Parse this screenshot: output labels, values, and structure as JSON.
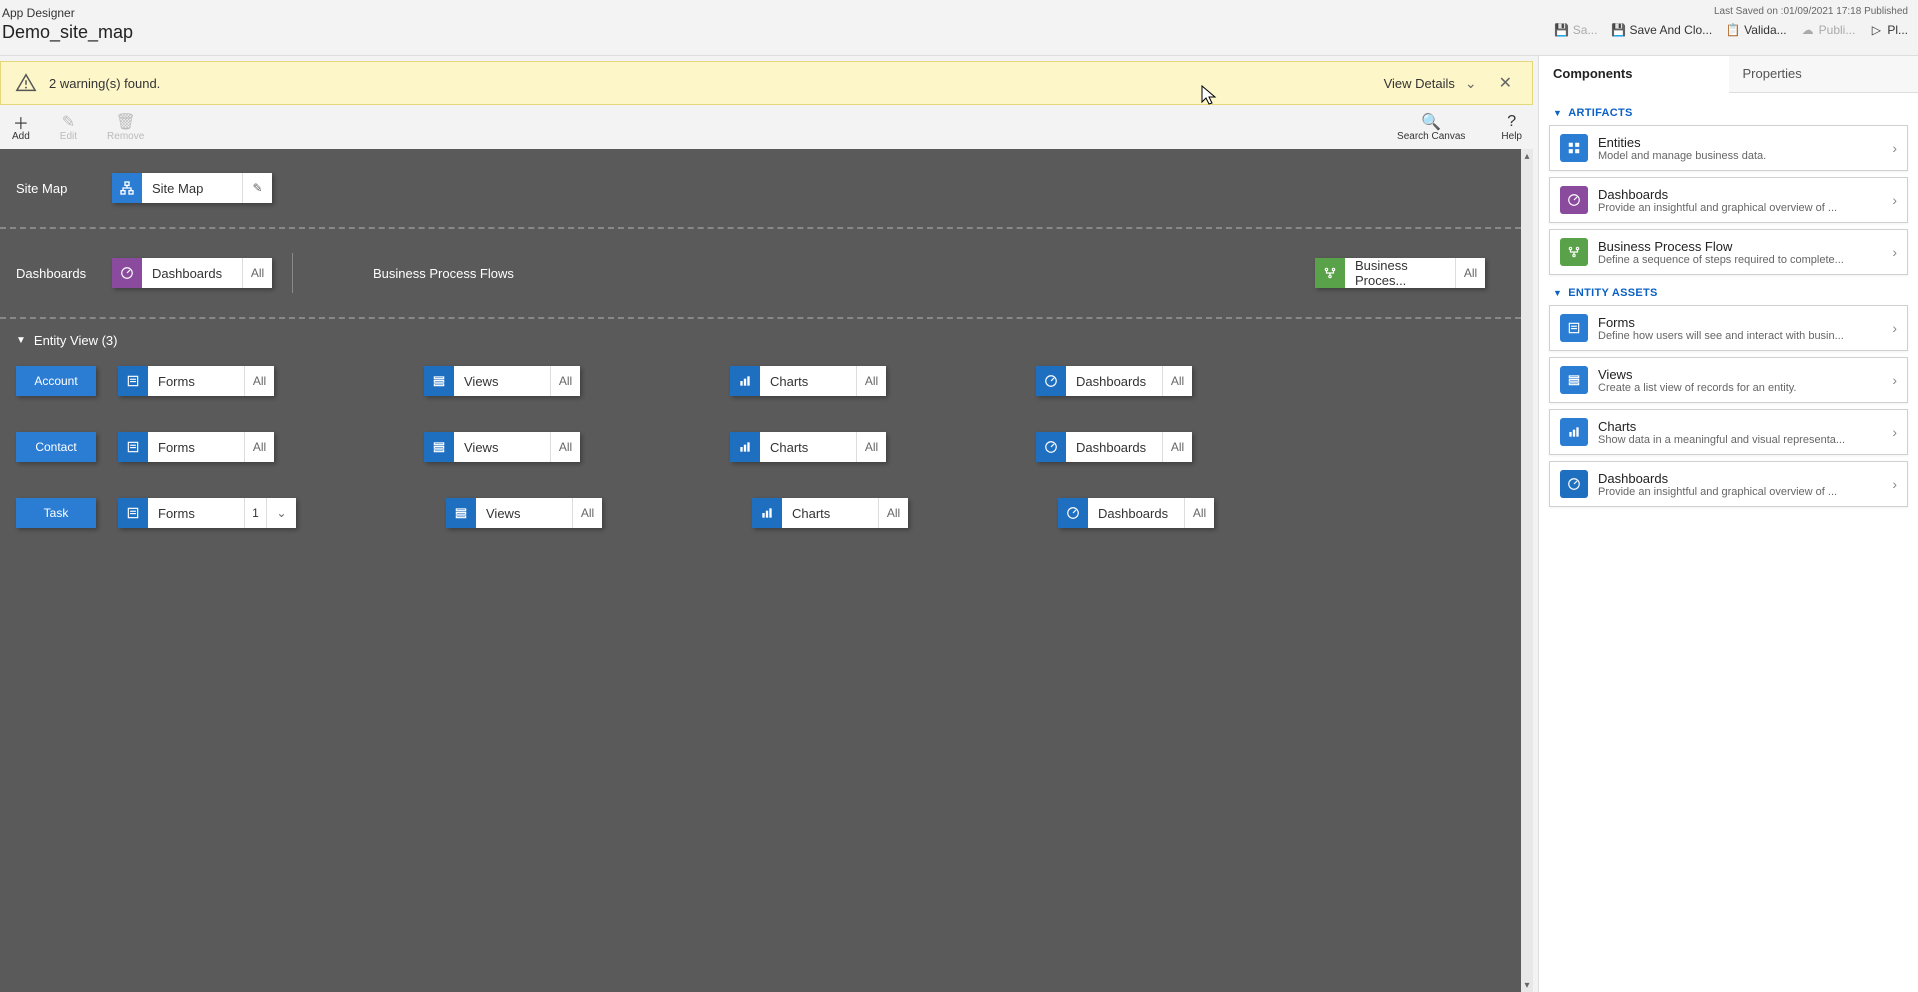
{
  "header": {
    "app_title": "App Designer",
    "app_name": "Demo_site_map",
    "last_saved": "Last Saved on :01/09/2021 17:18 Published",
    "actions": {
      "save": "Sa...",
      "save_and_close": "Save And Clo...",
      "validate": "Valida...",
      "publish": "Publi...",
      "play": "Pl..."
    }
  },
  "warning": {
    "text": "2 warning(s) found.",
    "view_details": "View Details"
  },
  "toolbar": {
    "add": "Add",
    "edit": "Edit",
    "remove": "Remove",
    "search": "Search Canvas",
    "help": "Help"
  },
  "canvas": {
    "sitemap": {
      "label": "Site Map",
      "tile": "Site Map"
    },
    "dashboards_row": {
      "label": "Dashboards",
      "tile": "Dashboards",
      "count": "All"
    },
    "bpf_row": {
      "label": "Business Process Flows",
      "tile": "Business Proces...",
      "count": "All"
    },
    "entity_view_header": "Entity View (3)",
    "entities": [
      {
        "name": "Account",
        "forms": {
          "label": "Forms",
          "count": "All"
        },
        "views": {
          "label": "Views",
          "count": "All"
        },
        "charts": {
          "label": "Charts",
          "count": "All"
        },
        "dashboards": {
          "label": "Dashboards",
          "count": "All"
        }
      },
      {
        "name": "Contact",
        "forms": {
          "label": "Forms",
          "count": "All"
        },
        "views": {
          "label": "Views",
          "count": "All"
        },
        "charts": {
          "label": "Charts",
          "count": "All"
        },
        "dashboards": {
          "label": "Dashboards",
          "count": "All"
        }
      },
      {
        "name": "Task",
        "forms": {
          "label": "Forms",
          "count": "1"
        },
        "views": {
          "label": "Views",
          "count": "All"
        },
        "charts": {
          "label": "Charts",
          "count": "All"
        },
        "dashboards": {
          "label": "Dashboards",
          "count": "All"
        }
      }
    ]
  },
  "panel": {
    "tabs": {
      "components": "Components",
      "properties": "Properties"
    },
    "groups": {
      "artifacts": "ARTIFACTS",
      "entity_assets": "ENTITY ASSETS"
    },
    "components": {
      "entities": {
        "title": "Entities",
        "desc": "Model and manage business data."
      },
      "dashboards": {
        "title": "Dashboards",
        "desc": "Provide an insightful and graphical overview of ..."
      },
      "bpf": {
        "title": "Business Process Flow",
        "desc": "Define a sequence of steps required to complete..."
      },
      "forms": {
        "title": "Forms",
        "desc": "Define how users will see and interact with busin..."
      },
      "views": {
        "title": "Views",
        "desc": "Create a list view of records for an entity."
      },
      "charts": {
        "title": "Charts",
        "desc": "Show data in a meaningful and visual representa..."
      },
      "dashboards2": {
        "title": "Dashboards",
        "desc": "Provide an insightful and graphical overview of ..."
      }
    }
  }
}
